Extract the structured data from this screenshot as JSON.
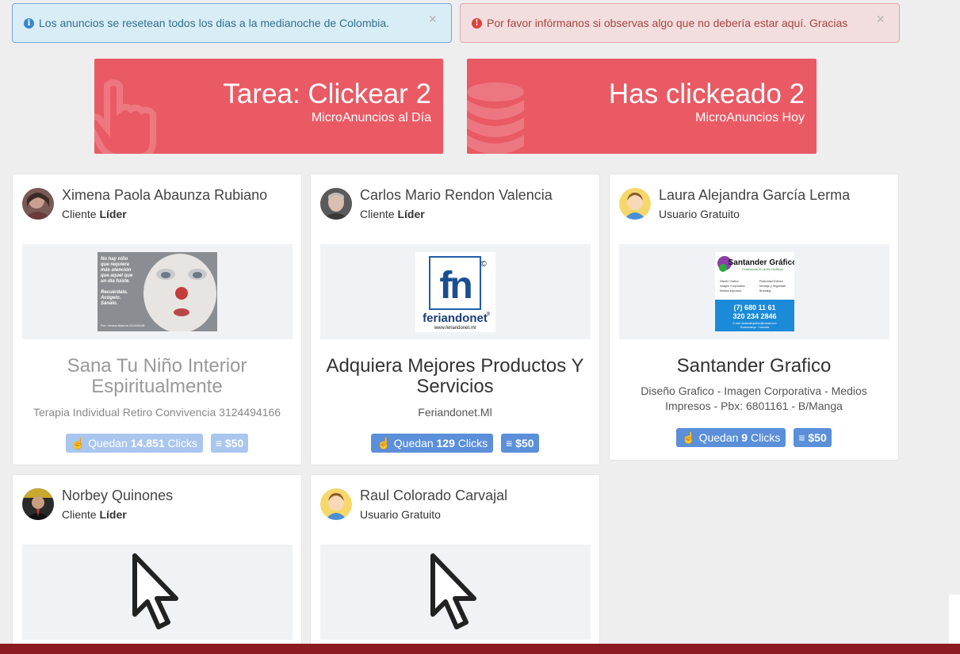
{
  "alerts": {
    "info_text": "Los anuncios se resetean todos los dias a la medianoche de Colombia.",
    "danger_text": "Por favor infórmanos si observas algo que no debería estar aquí. Gracias",
    "close_symbol": "×"
  },
  "stats": [
    {
      "big": "Tarea: Clickear 2",
      "small": "MicroAnuncios al Día",
      "icon": "hand-pointer-icon"
    },
    {
      "big": "Has clickeado 2",
      "small": "MicroAnuncios Hoy",
      "icon": "database-icon"
    }
  ],
  "cards": [
    {
      "name": "Ximena Paola Abaunza Rubiano",
      "role_prefix": "Cliente",
      "role_bold": "Líder",
      "title": "Sana Tu Niño Interior Espiritualmente",
      "subtitle": "Terapia Individual Retiro Convivencia 3124494166",
      "clicks_prefix": "Quedan",
      "clicks": "14.851",
      "clicks_suffix": "Clicks",
      "price": "$50",
      "image_text": {
        "l1": "No hay niño",
        "l2": "que requiera",
        "l3": "más atención",
        "l4": "que aquel que",
        "l5": "un día fuiste.",
        "l6": "Recuérdalo.",
        "l7": "Acógelo.",
        "l8": "Sánalo.",
        "footer": "Psic. Ximena Abaunza 3124494166"
      }
    },
    {
      "name": "Carlos Mario Rendon Valencia",
      "role_prefix": "Cliente",
      "role_bold": "Líder",
      "title": "Adquiera Mejores Productos Y Servicios",
      "subtitle": "Feriandonet.Ml",
      "clicks_prefix": "Quedan",
      "clicks": "129",
      "clicks_suffix": "Clicks",
      "price": "$50",
      "image_text": {
        "logo": "fn",
        "brand": "feriandonet",
        "url": "www.feriandonet.ml",
        "copy": "©",
        "reg": "®"
      }
    },
    {
      "name": "Laura Alejandra García Lerma",
      "role": "Usuario Gratuito",
      "title": "Santander Grafico",
      "subtitle": "Diseño Grafico - Imagen Corporativa - Medios Impresos - Pbx: 6801161 - B/Manga",
      "clicks_prefix": "Quedan",
      "clicks": "9",
      "clicks_suffix": "Clicks",
      "price": "$50",
      "image_text": {
        "brand": "Santander Gráfico",
        "tagline": "Profesional en Artes Gráficas",
        "c1a": "Diseño Grafico",
        "c1b": "Imagen Corporativa",
        "c1c": "Medios impresos",
        "c2a": "Publicidad Exterior",
        "c2b": "Montaje y Seguridad",
        "c2c": "Branding",
        "phone1": "(7) 680 11 61",
        "phone2": "320 234 2846",
        "email": "E-mail: santandergrafico@hotmail.com",
        "city": "Bucaramanga - Colombia"
      }
    },
    {
      "name": "Norbey Quinones",
      "role_prefix": "Cliente",
      "role_bold": "Líder"
    },
    {
      "name": "Raul Colorado Carvajal",
      "role": "Usuario Gratuito"
    }
  ],
  "colors": {
    "stat_red": "#e95a64",
    "badge_blue": "#5b8fd9",
    "footer": "#8b1a22"
  }
}
